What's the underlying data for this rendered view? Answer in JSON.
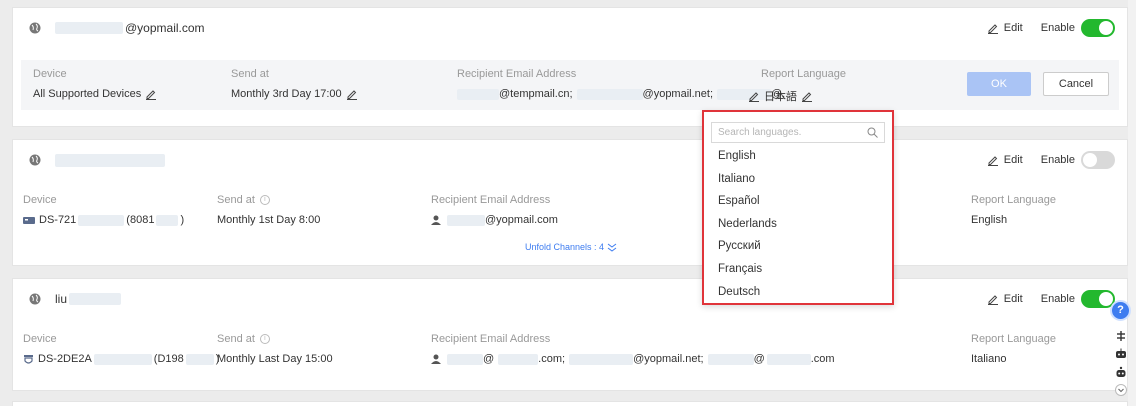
{
  "colors": {
    "accent": "#3d7cf0",
    "toggle_on": "#23b82e",
    "toggle_off": "#d9d9d9",
    "dropdown_border": "#e0343a",
    "ok_button": "#aac4f5"
  },
  "header": {
    "edit_label": "Edit",
    "enable_label": "Enable"
  },
  "rule1": {
    "title": "@yopmail.com",
    "enabled": true,
    "labels": {
      "device": "Device",
      "send_at": "Send at",
      "recipient": "Recipient Email Address",
      "language": "Report Language"
    },
    "device_value": "All Supported Devices",
    "send_at_value": "Monthly 3rd Day 17:00",
    "recipient_parts": [
      "@tempmail.cn;",
      "@yopmail.net;",
      "@..."
    ],
    "language_value": "日本語",
    "ok_label": "OK",
    "cancel_label": "Cancel"
  },
  "rule2": {
    "enabled": false,
    "labels": {
      "device": "Device",
      "send_at": "Send at",
      "recipient": "Recipient Email Address",
      "language": "Report Language"
    },
    "device_prefix": "DS-721",
    "device_mid": "(8081",
    "device_suffix": ")",
    "send_at_value": "Monthly 1st Day 8:00",
    "recipient_value": "@yopmail.com",
    "unfold_label": "Unfold Channels : 4",
    "language_value": "English"
  },
  "rule3": {
    "title_prefix": "liu",
    "enabled": true,
    "labels": {
      "device": "Device",
      "send_at": "Send at",
      "recipient": "Recipient Email Address",
      "language": "Report Language"
    },
    "device_prefix": "DS-2DE2A",
    "device_mid": "(D198",
    "device_suffix": ")",
    "send_at_value": "Monthly Last Day 15:00",
    "recipient_parts": [
      "@",
      ".com;",
      "@yopmail.net;",
      "@",
      ".com"
    ],
    "language_value": "Italiano"
  },
  "language_dropdown": {
    "search_placeholder": "Search languages.",
    "options": [
      "English",
      "Italiano",
      "Español",
      "Nederlands",
      "Русский",
      "Français",
      "Deutsch"
    ]
  },
  "side_widget": {
    "help_label": "?",
    "icons": [
      "help-icon",
      "adjust-icon",
      "robot-icon",
      "bot-icon",
      "chevron-down-icon"
    ]
  }
}
